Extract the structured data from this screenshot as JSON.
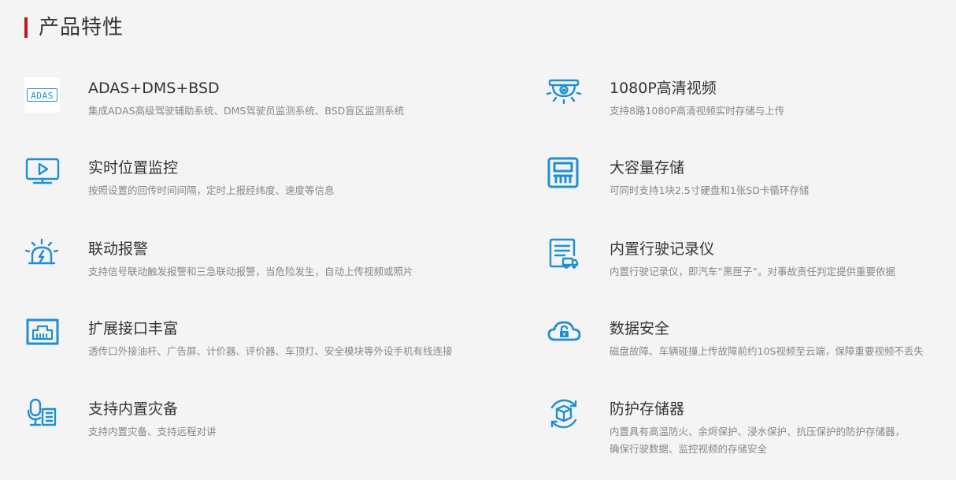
{
  "section": {
    "title": "产品特性",
    "accent_color": "#c8161e"
  },
  "icon_color": "#1e90d0",
  "features": [
    {
      "icon": "adas-icon",
      "icon_text": "ADAS",
      "name": "ADAS+DMS+BSD",
      "desc": "集成ADAS高级驾驶辅助系统、DMS驾驶员监测系统、BSD盲区监测系统"
    },
    {
      "icon": "camera-icon",
      "name": "1080P高清视频",
      "desc": "支持8路1080P高清视频实时存储与上传"
    },
    {
      "icon": "monitor-play-icon",
      "name": "实时位置监控",
      "desc": "按照设置的回传时间间隔，定时上报经纬度、速度等信息"
    },
    {
      "icon": "storage-card-icon",
      "name": "大容量存储",
      "desc": "可同时支持1块2.5寸硬盘和1张SD卡循环存储"
    },
    {
      "icon": "alarm-icon",
      "name": "联动报警",
      "desc": "支持信号联动触发报警和三急联动报警，当危险发生，自动上传视频或照片"
    },
    {
      "icon": "recorder-doc-icon",
      "name": "内置行驶记录仪",
      "desc": "内置行驶记录仪，即汽车“黑匣子”。对事故责任判定提供重要依据"
    },
    {
      "icon": "network-port-icon",
      "name": "扩展接口丰富",
      "desc": "透传口外接油杆、广告屏、计价器、评价器、车顶灯、安全模块等外设手机有线连接"
    },
    {
      "icon": "cloud-lock-icon",
      "name": "数据安全",
      "desc": "磁盘故障、车辆碰撞上传故障前约10S视频至云端，保障重要视频不丢失"
    },
    {
      "icon": "microphone-icon",
      "name": "支持内置灾备",
      "desc": "支持内置灾备、支持远程对讲"
    },
    {
      "icon": "protect-box-icon",
      "name": "防护存储器",
      "desc": "内置具有高温防火、余烬保护、浸水保护、抗压保护的防护存储器，",
      "desc2": "确保行驶数据、监控视频的存储安全"
    }
  ]
}
